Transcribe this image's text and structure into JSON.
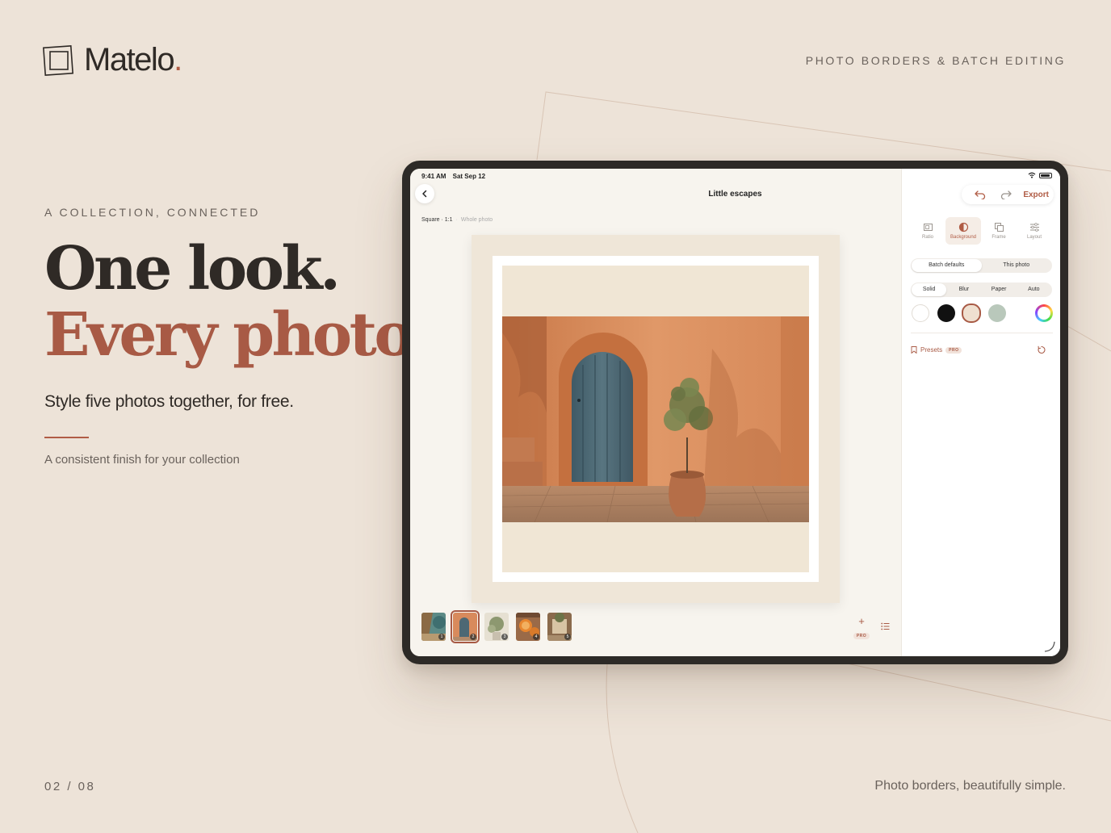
{
  "brand": {
    "name": "Matelo",
    "dot": "."
  },
  "header": {
    "tagline": "PHOTO BORDERS & BATCH EDITING"
  },
  "hero": {
    "eyebrow": "A COLLECTION, CONNECTED",
    "line1": "One look.",
    "line2": "Every photo.",
    "subtitle": "Style five photos together, for free.",
    "caption": "A consistent finish for your collection"
  },
  "footer": {
    "pager": "02 / 08",
    "tagline": "Photo borders, beautifully simple."
  },
  "app": {
    "status": {
      "time": "9:41 AM",
      "date": "Sat Sep 12"
    },
    "title": "Little escapes",
    "crumb": {
      "ratio": "Square · 1:1",
      "mode": "Whole photo"
    },
    "toolbar": {
      "export_label": "Export"
    },
    "tools": [
      {
        "label": "Ratio",
        "icon": "ratio-icon"
      },
      {
        "label": "Background",
        "icon": "background-icon"
      },
      {
        "label": "Frame",
        "icon": "frame-icon"
      },
      {
        "label": "Layout",
        "icon": "layout-icon"
      }
    ],
    "active_tool": "Background",
    "scope": {
      "options": [
        "Batch defaults",
        "This photo"
      ],
      "selected": "Batch defaults"
    },
    "bg_type": {
      "options": [
        "Solid",
        "Blur",
        "Paper",
        "Auto"
      ],
      "selected": "Solid"
    },
    "swatches": [
      {
        "name": "white",
        "color": "#ffffff"
      },
      {
        "name": "black",
        "color": "#111111"
      },
      {
        "name": "cream",
        "color": "#efe0d0",
        "selected": true
      },
      {
        "name": "sage",
        "color": "#b9c8bb"
      },
      {
        "name": "custom-color-picker",
        "color": "multicolor"
      }
    ],
    "presets": {
      "label": "Presets",
      "badge": "PRO"
    },
    "thumbnails": [
      {
        "num": "1"
      },
      {
        "num": "2",
        "selected": true
      },
      {
        "num": "3"
      },
      {
        "num": "4"
      },
      {
        "num": "5"
      }
    ],
    "add": {
      "badge": "PRO"
    }
  },
  "colors": {
    "accent": "#a85a45",
    "background": "#ede3d8",
    "text": "#2f2a26",
    "muted": "#6a625c"
  }
}
